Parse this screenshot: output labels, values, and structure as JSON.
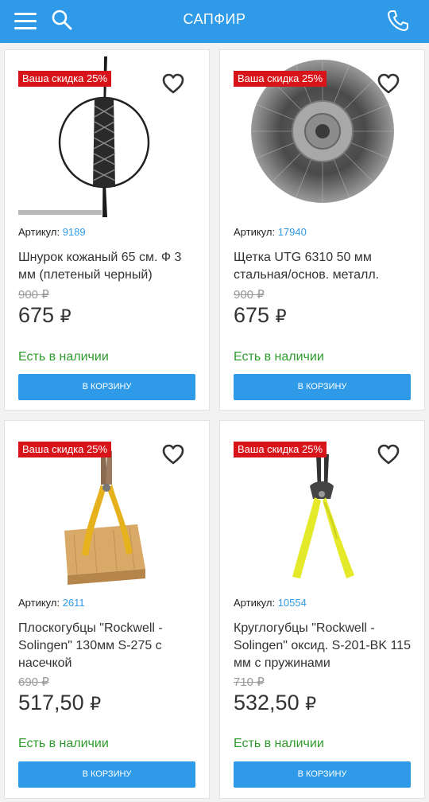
{
  "header": {
    "title": "САПФИР",
    "icons": [
      "menu-icon",
      "search-icon",
      "phone-icon"
    ],
    "color": "#2f9be8"
  },
  "product_card": {
    "article_label": "Артикул:",
    "stock_label": "Есть в наличии",
    "cart_label": "В КОРЗИНУ",
    "currency": "₽",
    "badge_color": "#d8141b",
    "stock_color": "#2e9c2c"
  },
  "products": [
    {
      "badge": "Ваша скидка 25%",
      "article": "9189",
      "name": "Шнурок кожаный 65 см. Ф 3 мм (плетеный черный)",
      "old_price": "900 ₽",
      "price": "675",
      "image": "braided-cord"
    },
    {
      "badge": "Ваша скидка 25%",
      "article": "17940",
      "name": "Щетка UTG 6310 50 мм стальная/основ. металл.",
      "old_price": "900 ₽",
      "price": "675",
      "image": "wire-brush-wheel"
    },
    {
      "badge": "Ваша скидка 25%",
      "article": "2611",
      "name": "Плоскогубцы \"Rockwell - Solingen\" 130мм S-275 с насечкой",
      "old_price": "690 ₽",
      "price": "517,50",
      "image": "flat-pliers"
    },
    {
      "badge": "Ваша скидка 25%",
      "article": "10554",
      "name": "Круглогубцы \"Rockwell - Solingen\" оксид. S-201-BK 115 мм с пружинами",
      "old_price": "710 ₽",
      "price": "532,50",
      "image": "round-nose-pliers"
    }
  ]
}
